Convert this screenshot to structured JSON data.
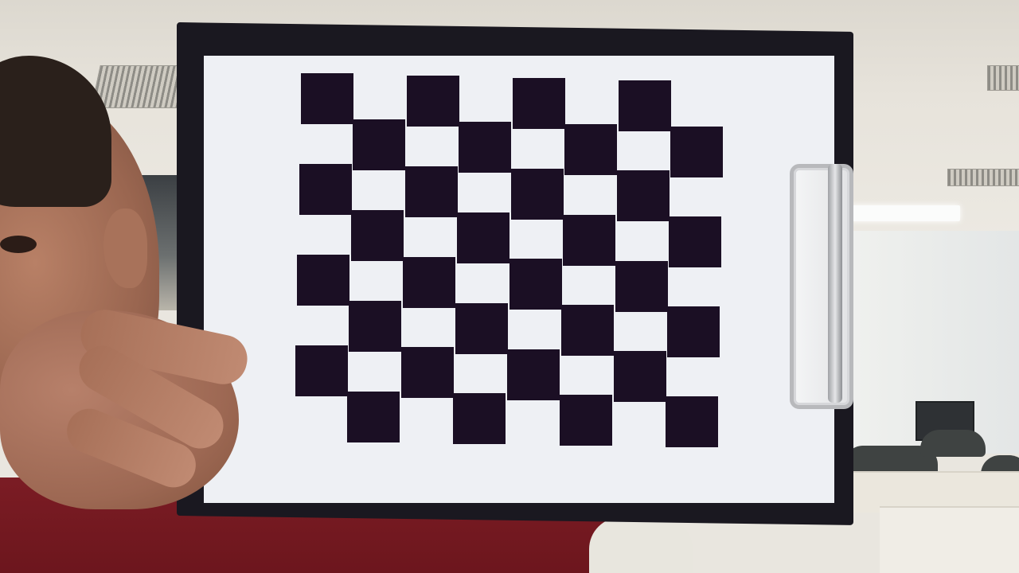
{
  "scene": {
    "subject": "",
    "board": {
      "rows": 8,
      "cols": 8,
      "dark_color": "#1b0f24",
      "light_color": "#eef0f4"
    },
    "colors": {
      "clipboard": "#1a1820",
      "shirt": "#7b1c24",
      "wall": "#e9e6df"
    }
  }
}
